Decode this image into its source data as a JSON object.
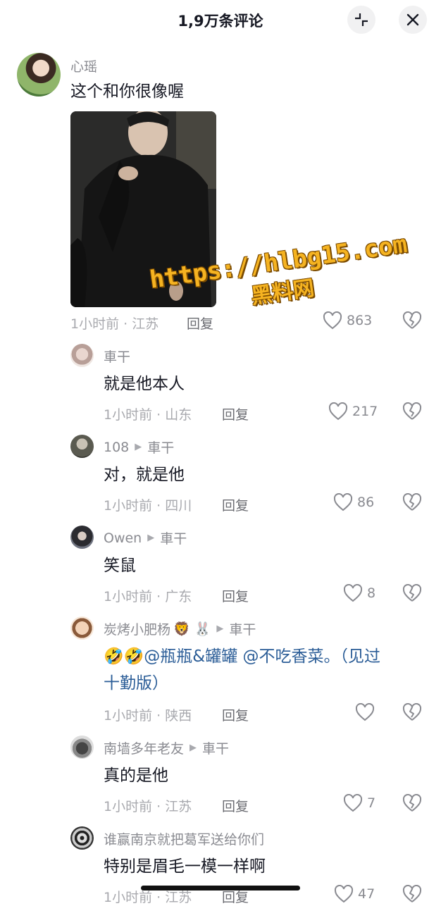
{
  "header": {
    "title": "1,9万条评论",
    "collapse_icon": "collapse-icon",
    "close_icon": "close-icon"
  },
  "comments": [
    {
      "username": "心瑶",
      "text": "这个和你很像喔",
      "meta": "1小时前 · 江苏",
      "reply": "回复",
      "likes": "863",
      "has_image": true
    },
    {
      "username": "車干",
      "text": "就是他本人",
      "meta": "1小时前 · 山东",
      "reply": "回复",
      "likes": "217"
    },
    {
      "username": "108",
      "reply_to": "車干",
      "text": "对，就是他",
      "meta": "1小时前 · 四川",
      "reply": "回复",
      "likes": "86"
    },
    {
      "username": "Owen",
      "reply_to": "車干",
      "text": "笑鼠",
      "meta": "1小时前 · 广东",
      "reply": "回复",
      "likes": "8"
    },
    {
      "username": "炭烤小肥杨",
      "username_emoji": "🦁 🐰",
      "reply_to": "車干",
      "text_prefix": "🤣🤣",
      "mention1": "@瓶瓶&罐罐",
      "mention2": "@不吃香菜",
      "text_suffix": "。（见过",
      "text_line2": "十勤版）",
      "meta": "1小时前 · 陕西",
      "reply": "回复",
      "likes": ""
    },
    {
      "username": "南墙多年老友",
      "reply_to": "車干",
      "text": "真的是他",
      "meta": "1小时前 · 江苏",
      "reply": "回复",
      "likes": "7"
    },
    {
      "username": "谁赢南京就把葛军送给你们",
      "text": "特别是眉毛一模一样啊",
      "meta": "1小时前 · 江苏",
      "reply": "回复",
      "likes": "47"
    }
  ],
  "watermark": {
    "url": "https://hlbg15.com",
    "name": "黑料网"
  }
}
